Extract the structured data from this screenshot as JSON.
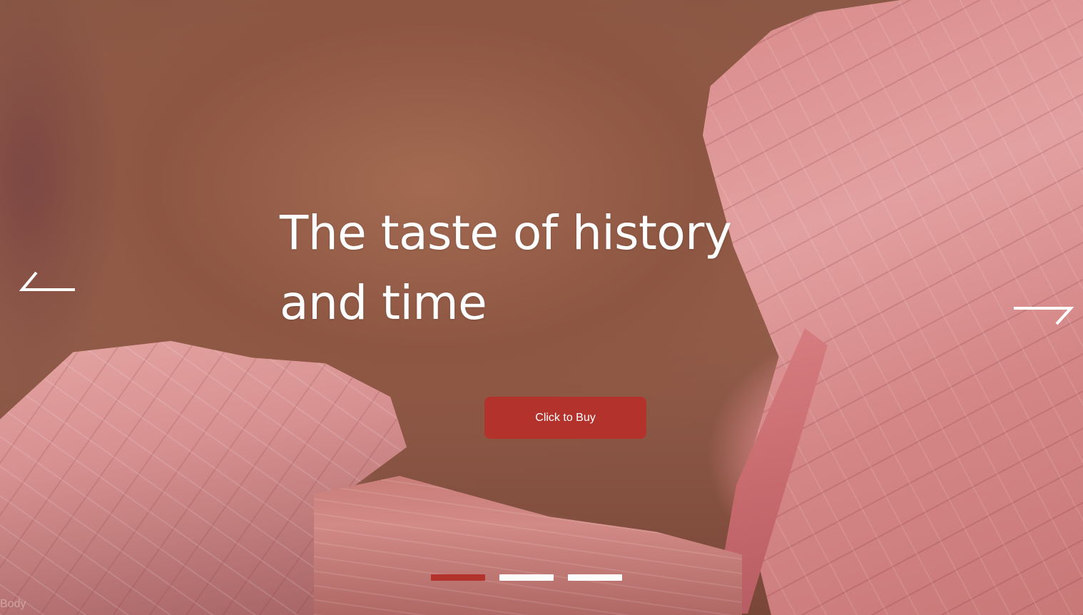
{
  "hero": {
    "title_line1": "The taste of history",
    "title_line2": "and time",
    "cta_label": "Click to Buy"
  },
  "navigation": {
    "prev_icon": "arrow-left-icon",
    "next_icon": "arrow-right-icon"
  },
  "slider": {
    "slide_count": 3,
    "active_index": 0,
    "active_color": "#b3332c",
    "inactive_color": "#ffffff"
  },
  "watermark": {
    "text": "Body"
  },
  "colors": {
    "cta_background": "#b3332c",
    "text": "#ffffff"
  }
}
